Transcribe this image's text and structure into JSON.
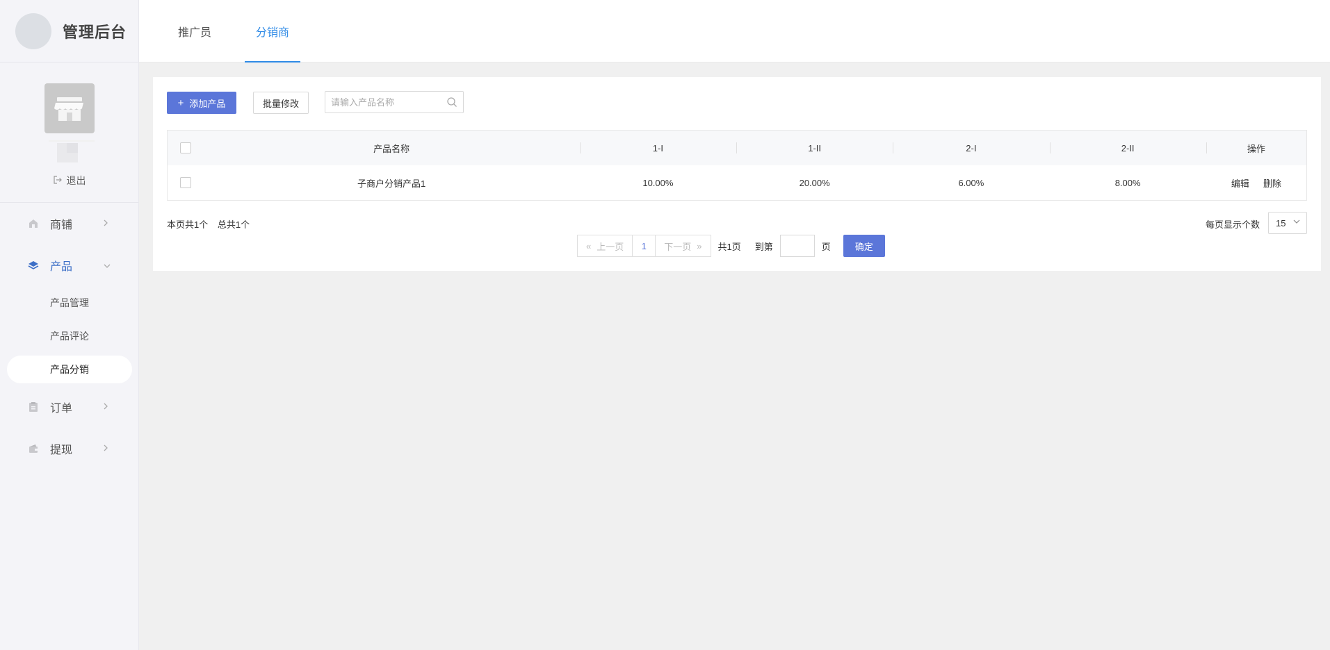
{
  "brand": {
    "title": "管理后台"
  },
  "profile": {
    "logout_label": "退出"
  },
  "sidebar": {
    "items": [
      {
        "label": "商铺",
        "icon": "home-icon"
      },
      {
        "label": "产品",
        "icon": "layers-icon",
        "active": true,
        "children": [
          {
            "label": "产品管理"
          },
          {
            "label": "产品评论"
          },
          {
            "label": "产品分销",
            "selected": true
          }
        ]
      },
      {
        "label": "订单",
        "icon": "clipboard-icon"
      },
      {
        "label": "提现",
        "icon": "wallet-icon"
      }
    ]
  },
  "tabs": [
    {
      "label": "推广员",
      "active": false
    },
    {
      "label": "分销商",
      "active": true
    }
  ],
  "toolbar": {
    "add_label": "添加产品",
    "batch_label": "批量修改",
    "search_placeholder": "请输入产品名称"
  },
  "table": {
    "headers": [
      "产品名称",
      "1-I",
      "1-II",
      "2-I",
      "2-II",
      "操作"
    ],
    "rows": [
      {
        "name": "子商户分销产品1",
        "v1": "10.00%",
        "v2": "20.00%",
        "v3": "6.00%",
        "v4": "8.00%",
        "edit": "编辑",
        "delete": "删除"
      }
    ]
  },
  "pagination": {
    "page_count_text": "本页共1个",
    "total_text": "总共1个",
    "prev_label": "上一页",
    "current_page": "1",
    "next_label": "下一页",
    "total_pages_text": "共1页",
    "goto_label": "到第",
    "page_unit": "页",
    "confirm_label": "确定",
    "per_page_label": "每页显示个数",
    "per_page_value": "15"
  },
  "colors": {
    "primary": "#5b76d9",
    "tab_active": "#2e8ae6",
    "sidebar_active": "#3d6fc7"
  }
}
